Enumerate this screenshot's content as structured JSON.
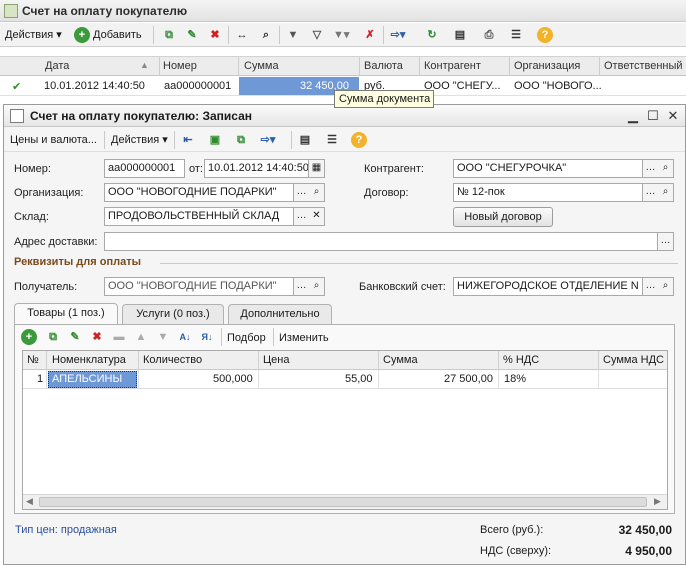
{
  "back_window": {
    "title": "Счет на оплату покупателю",
    "toolbar": {
      "actions_label": "Действия",
      "add_label": "Добавить"
    },
    "columns": [
      "Дата",
      "Номер",
      "Сумма",
      "Валюта",
      "Контрагент",
      "Организация",
      "Ответственный"
    ],
    "row": {
      "date": "10.01.2012 14:40:50",
      "number": "аа000000001",
      "sum": "32 450,00",
      "currency": "руб.",
      "counterparty": "ООО \"СНЕГУ...",
      "organization": "ООО \"НОВОГО..."
    },
    "tooltip": "Сумма документа"
  },
  "front_window": {
    "title": "Счет на оплату покупателю: Записан",
    "toolbar": {
      "prices_label": "Цены и валюта...",
      "actions_label": "Действия"
    },
    "form": {
      "number_label": "Номер:",
      "number_value": "аа000000001",
      "from_label": "от:",
      "date_value": "10.01.2012 14:40:50",
      "counterparty_label": "Контрагент:",
      "counterparty_value": "ООО \"СНЕГУРОЧКА\"",
      "organization_label": "Организация:",
      "organization_value": "ООО \"НОВОГОДНИЕ ПОДАРКИ\"",
      "contract_label": "Договор:",
      "contract_value": "№ 12-пок",
      "warehouse_label": "Склад:",
      "warehouse_value": "ПРОДОВОЛЬСТВЕННЫЙ СКЛАД",
      "new_contract_label": "Новый договор",
      "address_label": "Адрес доставки:",
      "address_value": "",
      "payment_section": "Реквизиты для оплаты",
      "recipient_label": "Получатель:",
      "recipient_value": "ООО \"НОВОГОДНИЕ ПОДАРКИ\"",
      "bank_label": "Банковский счет:",
      "bank_value": "НИЖЕГОРОДСКОЕ ОТДЕЛЕНИЕ N"
    },
    "tabs": [
      "Товары (1 поз.)",
      "Услуги (0 поз.)",
      "Дополнительно"
    ],
    "table_toolbar": {
      "select_label": "Подбор",
      "change_label": "Изменить"
    },
    "table": {
      "columns": [
        "№",
        "Номенклатура",
        "Количество",
        "Цена",
        "Сумма",
        "% НДС",
        "Сумма НДС"
      ],
      "rows": [
        {
          "n": "1",
          "item": "АПЕЛЬСИНЫ",
          "qty": "500,000",
          "price": "55,00",
          "sum": "27 500,00",
          "vat_pct": "18%",
          "vat_sum": ""
        }
      ]
    },
    "footer": {
      "price_type": "Тип цен: продажная",
      "total_label": "Всего (руб.):",
      "total_value": "32 450,00",
      "vat_label": "НДС (сверху):",
      "vat_value": "4 950,00"
    }
  },
  "colors": {
    "selection": "#6f98d6",
    "section_title": "#7b4a1a",
    "link": "#2a4f9e",
    "tooltip_bg": "#ffffe1"
  }
}
